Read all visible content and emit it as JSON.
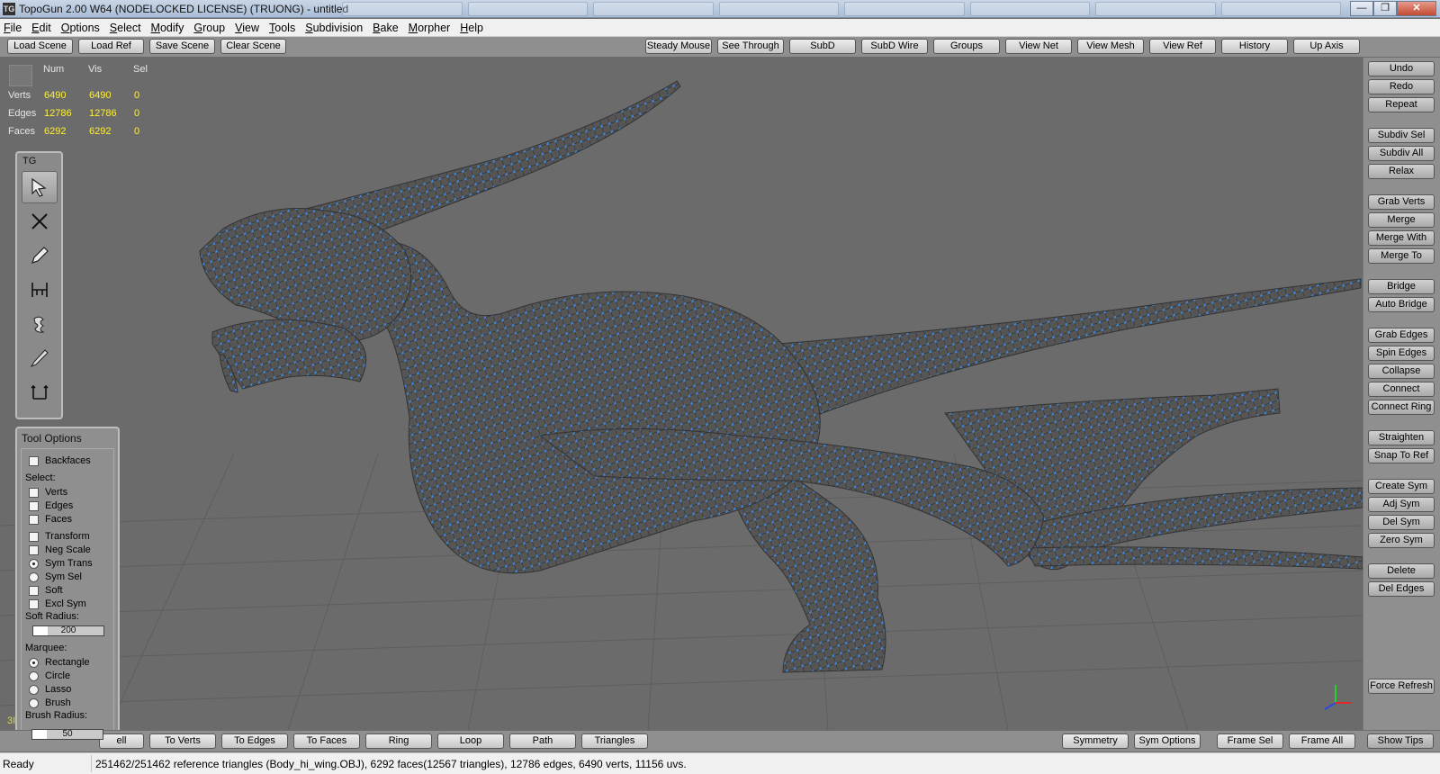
{
  "window": {
    "title": "TopoGun 2.00 W64  (NODELOCKED LICENSE) (TRUONG) - untitled",
    "icon": "TG",
    "controls": [
      "—",
      "❐",
      "✕"
    ]
  },
  "menu": [
    "File",
    "Edit",
    "Options",
    "Select",
    "Modify",
    "Group",
    "View",
    "Tools",
    "Subdivision",
    "Bake",
    "Morpher",
    "Help"
  ],
  "top_left_buttons": [
    "Load Scene",
    "Load Ref",
    "Save Scene",
    "Clear Scene"
  ],
  "top_right_buttons": [
    "Steady Mouse",
    "See Through",
    "SubD",
    "SubD Wire",
    "Groups",
    "View Net",
    "View Mesh",
    "View Ref",
    "History",
    "Up Axis"
  ],
  "stats": {
    "headers": [
      "Num",
      "Vis",
      "Sel"
    ],
    "rows": [
      {
        "label": "Verts",
        "num": "6490",
        "vis": "6490",
        "sel": "0"
      },
      {
        "label": "Edges",
        "num": "12786",
        "vis": "12786",
        "sel": "0"
      },
      {
        "label": "Faces",
        "num": "6292",
        "vis": "6292",
        "sel": "0"
      }
    ]
  },
  "tg_panel": {
    "title": "TG",
    "tools": [
      "select-tool-icon",
      "delete-tool-icon",
      "draw-tool-icon",
      "bridge-tool-icon",
      "extrude-tool-icon",
      "brush-tool-icon",
      "tweak-tool-icon"
    ]
  },
  "tool_options": {
    "title": "Tool Options",
    "backfaces": "Backfaces",
    "select_label": "Select:",
    "select_items": [
      "Verts",
      "Edges",
      "Faces"
    ],
    "transform_items": [
      "Transform",
      "Neg Scale"
    ],
    "sym_items": [
      "Sym Trans",
      "Sym Sel"
    ],
    "soft_items": [
      "Soft",
      "Excl Sym"
    ],
    "soft_radius_label": "Soft Radius:",
    "soft_radius": "200",
    "marquee_label": "Marquee:",
    "marquee_items": [
      "Rectangle",
      "Circle",
      "Lasso",
      "Brush"
    ],
    "marquee_selected": "Rectangle",
    "brush_radius_label": "Brush Radius:",
    "brush_radius": "50",
    "hidden_prefix": "3I"
  },
  "right_buttons": [
    "Undo",
    "Redo",
    "Repeat",
    "Subdiv Sel",
    "Subdiv All",
    "Relax",
    "Grab Verts",
    "Merge",
    "Merge With",
    "Merge To",
    "Bridge",
    "Auto Bridge",
    "Grab Edges",
    "Spin Edges",
    "Collapse",
    "Connect",
    "Connect Ring",
    "Straighten",
    "Snap To Ref",
    "Create Sym",
    "Adj Sym",
    "Del Sym",
    "Zero Sym",
    "Delete",
    "Del Edges",
    "Force Refresh",
    "Show Tips"
  ],
  "bottom_left_buttons": [
    "ell",
    "To Verts",
    "To Edges",
    "To Faces",
    "Ring",
    "Loop",
    "Path",
    "Triangles"
  ],
  "bottom_right_buttons": [
    "Symmetry",
    "Sym Options",
    "Frame Sel",
    "Frame All"
  ],
  "status": {
    "ready": "Ready",
    "info": "251462/251462 reference triangles (Body_hi_wing.OBJ), 6292 faces(12567 triangles), 12786 edges, 6490 verts, 11156 uvs."
  },
  "colors": {
    "viewport": "#6b6b6b",
    "wire": "#3a8be8",
    "mesh": "#565656",
    "stat_values": "#ffef3a"
  }
}
